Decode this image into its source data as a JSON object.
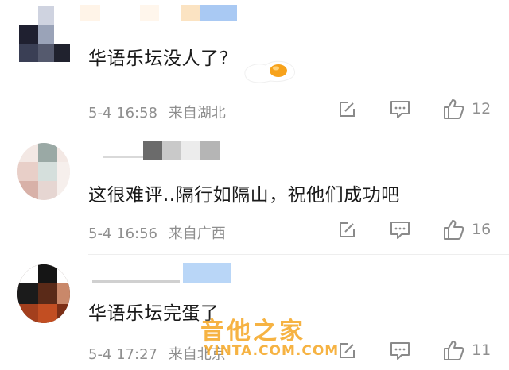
{
  "comments": [
    {
      "text": "华语乐坛没人了?",
      "time": "5-4 16:58",
      "location": "来自湖北",
      "likes": "12"
    },
    {
      "text": "这很难评..隔行如隔山，祝他们成功吧",
      "time": "5-4 16:56",
      "location": "来自广西",
      "likes": "16"
    },
    {
      "text": "华语乐坛完蛋了",
      "time": "5-4 17:27",
      "location": "来自北京",
      "likes": "11"
    }
  ],
  "icons": {
    "edit": "edit-icon",
    "comment": "comment-icon",
    "like": "thumbs-up-icon",
    "emoji": "fried-egg-emoji-icon"
  },
  "watermark": {
    "title": "音他之家",
    "subtitle": "YINTA.COM.COM"
  },
  "colors": {
    "text": "#1a1a1a",
    "meta": "#8f8f8f",
    "icon": "#8a8a8a",
    "watermark": "#f5a623"
  }
}
